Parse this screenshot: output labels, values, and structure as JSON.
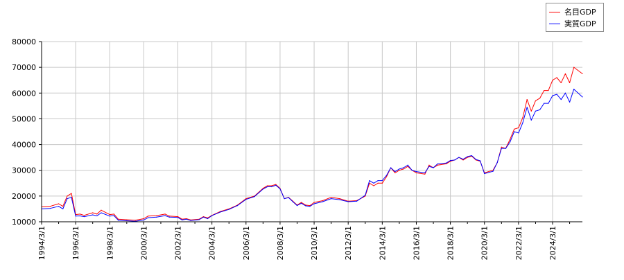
{
  "chart_data": {
    "type": "line",
    "title": "",
    "xlabel": "",
    "ylabel": "",
    "ylim": [
      10000,
      80000
    ],
    "yticks": [
      10000,
      20000,
      30000,
      40000,
      50000,
      60000,
      70000,
      80000
    ],
    "xlim": [
      "1994/3/1",
      "2025/12/1"
    ],
    "xticks": [
      "1994/3/1",
      "1996/3/1",
      "1998/3/1",
      "2000/3/1",
      "2002/3/1",
      "2004/3/1",
      "2006/3/1",
      "2008/3/1",
      "2010/3/1",
      "2012/3/1",
      "2014/3/1",
      "2016/3/1",
      "2018/3/1",
      "2020/3/1",
      "2022/3/1",
      "2024/3/1"
    ],
    "grid": true,
    "legend_position": "top-right",
    "series": [
      {
        "name": "名目GDP",
        "color": "#ff0000",
        "points": [
          [
            "1994/3/1",
            15800
          ],
          [
            "1994/9/1",
            16000
          ],
          [
            "1995/3/1",
            17000
          ],
          [
            "1995/6/1",
            16000
          ],
          [
            "1995/9/1",
            20000
          ],
          [
            "1995/12/1",
            21000
          ],
          [
            "1996/3/1",
            12800
          ],
          [
            "1996/6/1",
            13000
          ],
          [
            "1996/9/1",
            12500
          ],
          [
            "1997/3/1",
            13500
          ],
          [
            "1997/6/1",
            13000
          ],
          [
            "1997/9/1",
            14500
          ],
          [
            "1998/3/1",
            12800
          ],
          [
            "1998/6/1",
            13000
          ],
          [
            "1998/9/1",
            11000
          ],
          [
            "1999/3/1",
            10800
          ],
          [
            "1999/9/1",
            10600
          ],
          [
            "2000/3/1",
            11200
          ],
          [
            "2000/6/1",
            12200
          ],
          [
            "2000/12/1",
            12400
          ],
          [
            "2001/6/1",
            13000
          ],
          [
            "2001/9/1",
            12200
          ],
          [
            "2002/3/1",
            12000
          ],
          [
            "2002/6/1",
            11000
          ],
          [
            "2002/9/1",
            11200
          ],
          [
            "2002/12/1",
            10700
          ],
          [
            "2003/6/1",
            11000
          ],
          [
            "2003/9/1",
            12000
          ],
          [
            "2003/12/1",
            11500
          ],
          [
            "2004/3/1",
            12500
          ],
          [
            "2004/9/1",
            14000
          ],
          [
            "2005/3/1",
            15000
          ],
          [
            "2005/9/1",
            16500
          ],
          [
            "2006/3/1",
            19000
          ],
          [
            "2006/9/1",
            20000
          ],
          [
            "2007/3/1",
            23000
          ],
          [
            "2007/6/1",
            24000
          ],
          [
            "2007/9/1",
            24000
          ],
          [
            "2007/12/1",
            24500
          ],
          [
            "2008/3/1",
            23000
          ],
          [
            "2008/6/1",
            19000
          ],
          [
            "2008/9/1",
            19500
          ],
          [
            "2008/12/1",
            18000
          ],
          [
            "2009/3/1",
            16500
          ],
          [
            "2009/6/1",
            17500
          ],
          [
            "2009/9/1",
            16500
          ],
          [
            "2009/12/1",
            16300
          ],
          [
            "2010/3/1",
            17500
          ],
          [
            "2010/9/1",
            18200
          ],
          [
            "2011/3/1",
            19500
          ],
          [
            "2011/9/1",
            19000
          ],
          [
            "2012/3/1",
            18000
          ],
          [
            "2012/9/1",
            18200
          ],
          [
            "2013/3/1",
            20000
          ],
          [
            "2013/6/1",
            25000
          ],
          [
            "2013/9/1",
            24000
          ],
          [
            "2013/12/1",
            25000
          ],
          [
            "2014/3/1",
            25000
          ],
          [
            "2014/6/1",
            27500
          ],
          [
            "2014/9/1",
            31000
          ],
          [
            "2014/12/1",
            29000
          ],
          [
            "2015/3/1",
            30000
          ],
          [
            "2015/6/1",
            30500
          ],
          [
            "2015/9/1",
            31500
          ],
          [
            "2015/12/1",
            30000
          ],
          [
            "2016/3/1",
            29000
          ],
          [
            "2016/9/1",
            28500
          ],
          [
            "2016/12/1",
            32000
          ],
          [
            "2017/3/1",
            31000
          ],
          [
            "2017/6/1",
            32000
          ],
          [
            "2017/12/1",
            32500
          ],
          [
            "2018/3/1",
            33500
          ],
          [
            "2018/6/1",
            34000
          ],
          [
            "2018/9/1",
            35000
          ],
          [
            "2018/12/1",
            34000
          ],
          [
            "2019/3/1",
            35000
          ],
          [
            "2019/6/1",
            35500
          ],
          [
            "2019/9/1",
            34000
          ],
          [
            "2019/12/1",
            33500
          ],
          [
            "2020/3/1",
            29000
          ],
          [
            "2020/9/1",
            30000
          ],
          [
            "2020/12/1",
            33000
          ],
          [
            "2021/3/1",
            39000
          ],
          [
            "2021/6/1",
            38500
          ],
          [
            "2021/9/1",
            42000
          ],
          [
            "2021/12/1",
            46000
          ],
          [
            "2022/3/1",
            46500
          ],
          [
            "2022/6/1",
            50500
          ],
          [
            "2022/9/1",
            57500
          ],
          [
            "2022/12/1",
            53000
          ],
          [
            "2023/3/1",
            57000
          ],
          [
            "2023/6/1",
            58000
          ],
          [
            "2023/9/1",
            61000
          ],
          [
            "2023/12/1",
            61000
          ],
          [
            "2024/3/1",
            65000
          ],
          [
            "2024/6/1",
            66000
          ],
          [
            "2024/9/1",
            64000
          ],
          [
            "2024/12/1",
            67500
          ],
          [
            "2025/3/1",
            64000
          ],
          [
            "2025/6/1",
            70000
          ],
          [
            "2025/12/1",
            67500
          ]
        ]
      },
      {
        "name": "実質GDP",
        "color": "#0000ff",
        "points": [
          [
            "1994/3/1",
            15000
          ],
          [
            "1994/9/1",
            15200
          ],
          [
            "1995/3/1",
            16000
          ],
          [
            "1995/6/1",
            15000
          ],
          [
            "1995/9/1",
            19000
          ],
          [
            "1995/12/1",
            19500
          ],
          [
            "1996/3/1",
            12200
          ],
          [
            "1996/6/1",
            12300
          ],
          [
            "1996/9/1",
            12000
          ],
          [
            "1997/3/1",
            12700
          ],
          [
            "1997/6/1",
            12300
          ],
          [
            "1997/9/1",
            13500
          ],
          [
            "1998/3/1",
            12200
          ],
          [
            "1998/6/1",
            12400
          ],
          [
            "1998/9/1",
            10600
          ],
          [
            "1999/3/1",
            10400
          ],
          [
            "1999/9/1",
            10200
          ],
          [
            "2000/3/1",
            10700
          ],
          [
            "2000/6/1",
            11600
          ],
          [
            "2000/12/1",
            11800
          ],
          [
            "2001/6/1",
            12400
          ],
          [
            "2001/9/1",
            11800
          ],
          [
            "2002/3/1",
            11700
          ],
          [
            "2002/6/1",
            10700
          ],
          [
            "2002/9/1",
            11000
          ],
          [
            "2002/12/1",
            10500
          ],
          [
            "2003/6/1",
            10800
          ],
          [
            "2003/9/1",
            11800
          ],
          [
            "2003/12/1",
            11200
          ],
          [
            "2004/3/1",
            12400
          ],
          [
            "2004/9/1",
            13800
          ],
          [
            "2005/3/1",
            14800
          ],
          [
            "2005/9/1",
            16300
          ],
          [
            "2006/3/1",
            18700
          ],
          [
            "2006/9/1",
            19800
          ],
          [
            "2007/3/1",
            22700
          ],
          [
            "2007/6/1",
            23600
          ],
          [
            "2007/9/1",
            23600
          ],
          [
            "2007/12/1",
            24200
          ],
          [
            "2008/3/1",
            22800
          ],
          [
            "2008/6/1",
            19000
          ],
          [
            "2008/9/1",
            19400
          ],
          [
            "2008/12/1",
            17800
          ],
          [
            "2009/3/1",
            16300
          ],
          [
            "2009/6/1",
            17200
          ],
          [
            "2009/9/1",
            16200
          ],
          [
            "2009/12/1",
            16000
          ],
          [
            "2010/3/1",
            17000
          ],
          [
            "2010/9/1",
            17800
          ],
          [
            "2011/3/1",
            19000
          ],
          [
            "2011/9/1",
            18600
          ],
          [
            "2012/3/1",
            17800
          ],
          [
            "2012/9/1",
            18000
          ],
          [
            "2013/3/1",
            20300
          ],
          [
            "2013/6/1",
            26000
          ],
          [
            "2013/9/1",
            25000
          ],
          [
            "2013/12/1",
            26000
          ],
          [
            "2014/3/1",
            26000
          ],
          [
            "2014/6/1",
            28000
          ],
          [
            "2014/9/1",
            31000
          ],
          [
            "2014/12/1",
            29500
          ],
          [
            "2015/3/1",
            30500
          ],
          [
            "2015/6/1",
            31000
          ],
          [
            "2015/9/1",
            32000
          ],
          [
            "2015/12/1",
            30000
          ],
          [
            "2016/3/1",
            29500
          ],
          [
            "2016/9/1",
            29000
          ],
          [
            "2016/12/1",
            31500
          ],
          [
            "2017/3/1",
            31000
          ],
          [
            "2017/6/1",
            32500
          ],
          [
            "2017/12/1",
            32800
          ],
          [
            "2018/3/1",
            33800
          ],
          [
            "2018/6/1",
            34000
          ],
          [
            "2018/9/1",
            35000
          ],
          [
            "2018/12/1",
            34300
          ],
          [
            "2019/3/1",
            35300
          ],
          [
            "2019/6/1",
            35700
          ],
          [
            "2019/9/1",
            34200
          ],
          [
            "2019/12/1",
            33700
          ],
          [
            "2020/3/1",
            28700
          ],
          [
            "2020/9/1",
            29600
          ],
          [
            "2020/12/1",
            33000
          ],
          [
            "2021/3/1",
            38500
          ],
          [
            "2021/6/1",
            38500
          ],
          [
            "2021/9/1",
            41000
          ],
          [
            "2021/12/1",
            45000
          ],
          [
            "2022/3/1",
            44500
          ],
          [
            "2022/6/1",
            48500
          ],
          [
            "2022/9/1",
            54500
          ],
          [
            "2022/12/1",
            49500
          ],
          [
            "2023/3/1",
            53000
          ],
          [
            "2023/6/1",
            53500
          ],
          [
            "2023/9/1",
            56000
          ],
          [
            "2023/12/1",
            56000
          ],
          [
            "2024/3/1",
            59000
          ],
          [
            "2024/6/1",
            59500
          ],
          [
            "2024/9/1",
            57500
          ],
          [
            "2024/12/1",
            60000
          ],
          [
            "2025/3/1",
            56500
          ],
          [
            "2025/6/1",
            61500
          ],
          [
            "2025/12/1",
            58500
          ]
        ]
      }
    ]
  }
}
